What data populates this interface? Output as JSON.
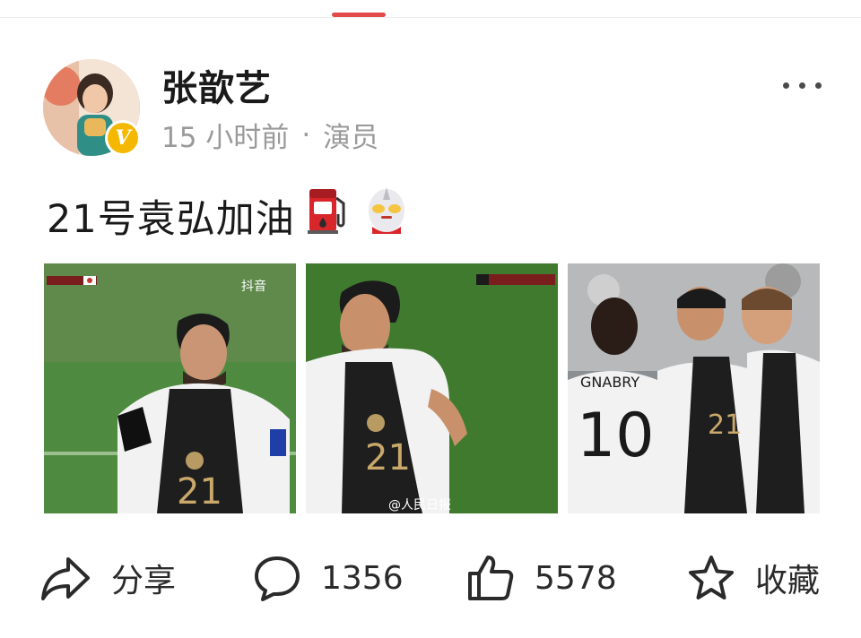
{
  "post": {
    "author": "张歆艺",
    "time": "15 小时前",
    "separator": "·",
    "category": "演员",
    "text": "21号袁弘加油",
    "emojis": [
      "fuel-pump-emoji",
      "ultraman-emoji"
    ]
  },
  "images": [
    {
      "name": "photo-1",
      "watermark": "抖音",
      "jersey": "21"
    },
    {
      "name": "photo-2",
      "watermark": "@人民日报",
      "jersey": "21"
    },
    {
      "name": "photo-3",
      "watermark": "",
      "jersey_a": "10",
      "jersey_b": "21",
      "name_text": "GNABRY"
    }
  ],
  "actions": {
    "share": "分享",
    "comment": "1356",
    "like": "5578",
    "favorite": "收藏"
  },
  "colors": {
    "accent": "#e24a4a",
    "verified": "#f5b800",
    "meta_gray": "#9a9a9a"
  }
}
